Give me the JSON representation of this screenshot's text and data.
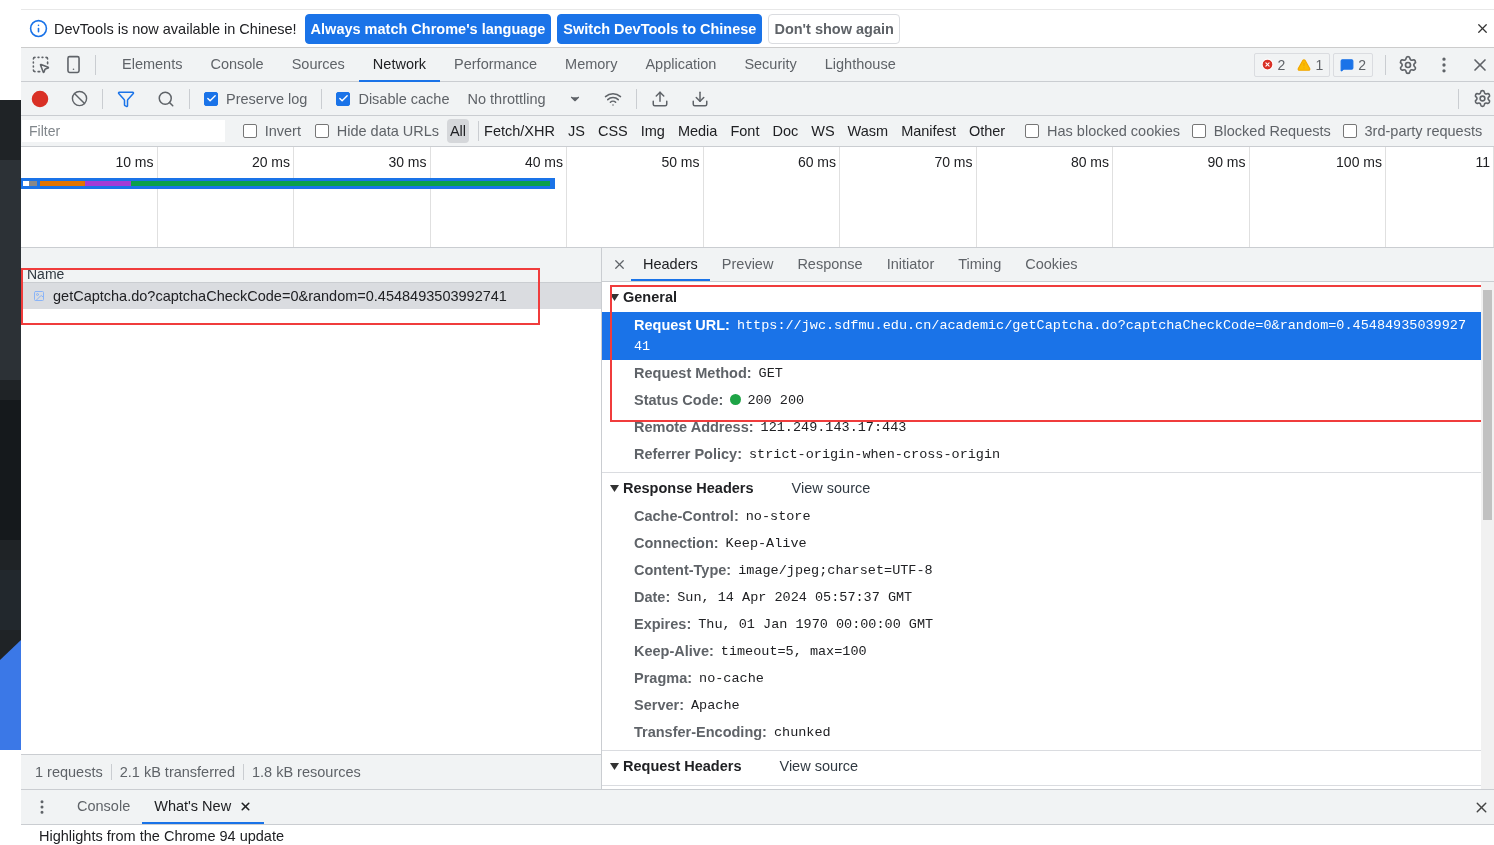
{
  "infobar": {
    "message": "DevTools is now available in Chinese!",
    "buttons": [
      {
        "label": "Always match Chrome's language",
        "kind": "primary"
      },
      {
        "label": "Switch DevTools to Chinese",
        "kind": "primary"
      },
      {
        "label": "Don't show again",
        "kind": "secondary"
      }
    ]
  },
  "panel_tabs": [
    {
      "label": "Elements",
      "selected": false
    },
    {
      "label": "Console",
      "selected": false
    },
    {
      "label": "Sources",
      "selected": false
    },
    {
      "label": "Network",
      "selected": true
    },
    {
      "label": "Performance",
      "selected": false
    },
    {
      "label": "Memory",
      "selected": false
    },
    {
      "label": "Application",
      "selected": false
    },
    {
      "label": "Security",
      "selected": false
    },
    {
      "label": "Lighthouse",
      "selected": false
    }
  ],
  "issue_counts": {
    "errors": "2",
    "warnings": "1",
    "messages": "2"
  },
  "toolbar": {
    "recording": true,
    "preserve_log": {
      "label": "Preserve log",
      "checked": true
    },
    "disable_cache": {
      "label": "Disable cache",
      "checked": true
    },
    "throttling": "No throttling"
  },
  "filter": {
    "placeholder": "Filter",
    "invert": {
      "label": "Invert",
      "checked": false
    },
    "hide_data_urls": {
      "label": "Hide data URLs",
      "checked": false
    },
    "types": [
      {
        "label": "All",
        "selected": true
      },
      {
        "label": "Fetch/XHR",
        "selected": false
      },
      {
        "label": "JS",
        "selected": false
      },
      {
        "label": "CSS",
        "selected": false
      },
      {
        "label": "Img",
        "selected": false
      },
      {
        "label": "Media",
        "selected": false
      },
      {
        "label": "Font",
        "selected": false
      },
      {
        "label": "Doc",
        "selected": false
      },
      {
        "label": "WS",
        "selected": false
      },
      {
        "label": "Wasm",
        "selected": false
      },
      {
        "label": "Manifest",
        "selected": false
      },
      {
        "label": "Other",
        "selected": false
      }
    ],
    "options": [
      {
        "label": "Has blocked cookies",
        "checked": false
      },
      {
        "label": "Blocked Requests",
        "checked": false
      },
      {
        "label": "3rd-party requests",
        "checked": false
      }
    ]
  },
  "timeline": {
    "ticks": [
      "10 ms",
      "20 ms",
      "30 ms",
      "40 ms",
      "50 ms",
      "60 ms",
      "70 ms",
      "80 ms",
      "90 ms",
      "100 ms",
      "11"
    ]
  },
  "requests": {
    "column": "Name",
    "rows": [
      {
        "name": "getCaptcha.do?captchaCheckCode=0&random=0.4548493503992741",
        "selected": true,
        "annotated": true
      }
    ]
  },
  "summary": [
    "1 requests",
    "2.1 kB transferred",
    "1.8 kB resources"
  ],
  "details": {
    "tabs": [
      {
        "label": "Headers",
        "selected": true
      },
      {
        "label": "Preview",
        "selected": false
      },
      {
        "label": "Response",
        "selected": false
      },
      {
        "label": "Initiator",
        "selected": false
      },
      {
        "label": "Timing",
        "selected": false
      },
      {
        "label": "Cookies",
        "selected": false
      }
    ],
    "sections": [
      {
        "title": "General",
        "expanded": true,
        "annotated": true,
        "rows": [
          {
            "key": "Request URL:",
            "value": "https://jwc.sdfmu.edu.cn/academic/getCaptcha.do?captchaCheckCode=0&random=0.4548493503992741",
            "highlighted": true
          },
          {
            "key": "Request Method:",
            "value": "GET",
            "highlighted": false
          },
          {
            "key": "Status Code:",
            "value": "200 200",
            "highlighted": false,
            "color": "#1ea446"
          },
          {
            "key": "Remote Address:",
            "value": "121.249.143.17:443",
            "highlighted": false
          },
          {
            "key": "Referrer Policy:",
            "value": "strict-origin-when-cross-origin",
            "highlighted": false
          }
        ]
      },
      {
        "title": "Response Headers",
        "expanded": true,
        "view_source": "View source",
        "rows": [
          {
            "key": "Cache-Control:",
            "value": "no-store",
            "highlighted": false
          },
          {
            "key": "Connection:",
            "value": "Keep-Alive",
            "highlighted": false
          },
          {
            "key": "Content-Type:",
            "value": "image/jpeg;charset=UTF-8",
            "highlighted": false
          },
          {
            "key": "Date:",
            "value": "Sun, 14 Apr 2024 05:57:37 GMT",
            "highlighted": false
          },
          {
            "key": "Expires:",
            "value": "Thu, 01 Jan 1970 00:00:00 GMT",
            "highlighted": false
          },
          {
            "key": "Keep-Alive:",
            "value": "timeout=5, max=100",
            "highlighted": false
          },
          {
            "key": "Pragma:",
            "value": "no-cache",
            "highlighted": false
          },
          {
            "key": "Server:",
            "value": "Apache",
            "highlighted": false
          },
          {
            "key": "Transfer-Encoding:",
            "value": "chunked",
            "highlighted": false
          }
        ]
      },
      {
        "title": "Request Headers",
        "expanded": true,
        "view_source": "View source"
      }
    ]
  },
  "drawer": {
    "tabs": [
      {
        "label": "Console",
        "selected": false
      },
      {
        "label": "What's New",
        "selected": true,
        "closable": true
      }
    ],
    "text": "Highlights from the Chrome 94 update"
  }
}
